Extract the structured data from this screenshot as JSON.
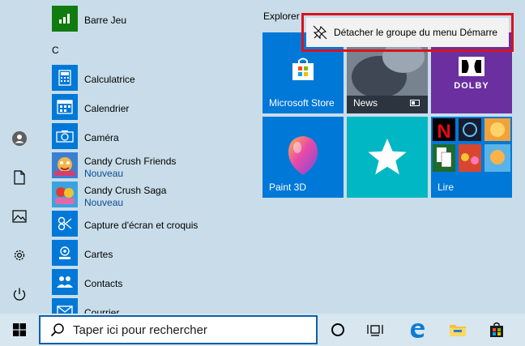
{
  "app_list": {
    "items": [
      {
        "id": "barre-jeu",
        "name": "Barre Jeu",
        "sub": ""
      },
      {
        "id": "calculatrice",
        "name": "Calculatrice",
        "sub": ""
      },
      {
        "id": "calendrier",
        "name": "Calendrier",
        "sub": ""
      },
      {
        "id": "camera",
        "name": "Caméra",
        "sub": ""
      },
      {
        "id": "candy-friends",
        "name": "Candy Crush Friends",
        "sub": "Nouveau"
      },
      {
        "id": "candy-saga",
        "name": "Candy Crush Saga",
        "sub": "Nouveau"
      },
      {
        "id": "capture",
        "name": "Capture d'écran et croquis",
        "sub": ""
      },
      {
        "id": "cartes",
        "name": "Cartes",
        "sub": ""
      },
      {
        "id": "contacts",
        "name": "Contacts",
        "sub": ""
      },
      {
        "id": "courrier",
        "name": "Courrier",
        "sub": ""
      }
    ],
    "letter_c": "C"
  },
  "tiles": {
    "group_title": "Explorer",
    "items": [
      {
        "label": "Microsoft Store"
      },
      {
        "label": "News"
      },
      {
        "label": "DOLBY"
      },
      {
        "label": "Paint 3D"
      },
      {
        "label": ""
      },
      {
        "label": "Lire"
      }
    ]
  },
  "context_menu": {
    "item_label": "Détacher le groupe du menu Démarre"
  },
  "taskbar": {
    "search_placeholder": "Taper ici pour rechercher"
  },
  "colors": {
    "tile_blue": "#0078d7",
    "tile_teal": "#00b7c3",
    "dolby_purple": "#6b2fa0",
    "highlight_red": "#d8131c",
    "search_border": "#0f5fa8"
  }
}
